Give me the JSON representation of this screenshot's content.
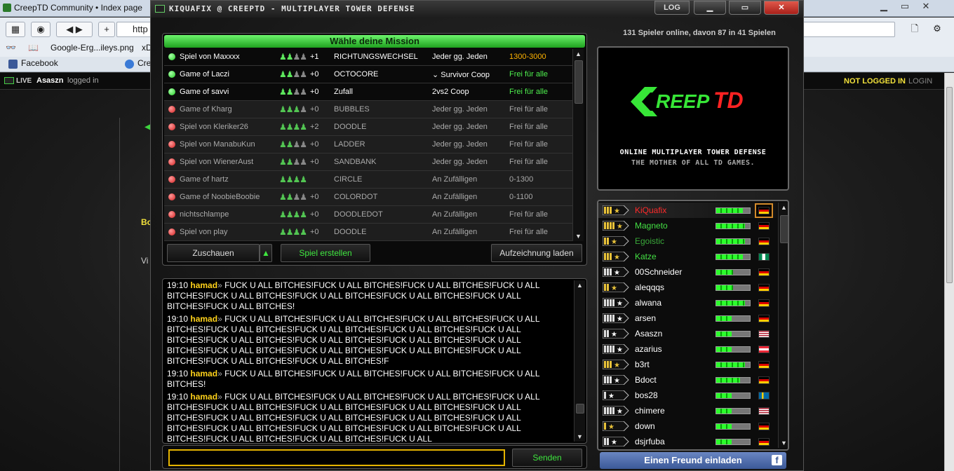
{
  "browser": {
    "tab_title": "CreepTD Community • Index page",
    "url_fragment": "http",
    "bookmarks": [
      "Google-Erg...ileys.png",
      "xD"
    ],
    "tabs": [
      "Facebook",
      "Cre"
    ],
    "site_bar": {
      "live_label": "LIVE",
      "username": "Asaszn",
      "logged_in": "logged in",
      "not_logged_in": "NOT LOGGED IN",
      "login": "LOGIN"
    },
    "page_bits": {
      "bo": "Bo",
      "vi": "Vi"
    }
  },
  "app": {
    "title": "KIQUAFIX @ CREEPTD - MULTIPLAYER TOWER DEFENSE",
    "log_button": "LOG",
    "minimize": "▁",
    "maximize": "▭",
    "close": "✕"
  },
  "missions": {
    "header": "Wähle deine Mission",
    "rows": [
      {
        "name": "Spiel von Maxxxx",
        "on": 2,
        "off": 2,
        "plus": "+1",
        "map": "RICHTUNGSWECHSEL",
        "mode": "Jeder gg. Jeden",
        "range": "1300-3000",
        "range_color": "orange",
        "state": "open"
      },
      {
        "name": "Game of Laczi",
        "on": 2,
        "off": 2,
        "plus": "+0",
        "map": "OCTOCORE",
        "mode": "⌄ Survivor Coop",
        "range": "Frei für alle",
        "range_color": "green",
        "state": "open"
      },
      {
        "name": "Game of savvi",
        "on": 2,
        "off": 2,
        "plus": "+0",
        "map": "Zufall",
        "mode": "2vs2 Coop",
        "range": "Frei für alle",
        "range_color": "green",
        "state": "open"
      },
      {
        "name": "Game of Kharg",
        "on": 3,
        "off": 1,
        "plus": "+0",
        "map": "BUBBLES",
        "mode": "Jeder gg. Jeden",
        "range": "Frei für alle",
        "range_color": "green",
        "state": "closed"
      },
      {
        "name": "Spiel von Kleriker26",
        "on": 4,
        "off": 0,
        "plus": "+2",
        "map": "DOODLE",
        "mode": "Jeder gg. Jeden",
        "range": "Frei für alle",
        "range_color": "green",
        "state": "closed"
      },
      {
        "name": "Spiel von ManabuKun",
        "on": 2,
        "off": 2,
        "plus": "+0",
        "map": "LADDER",
        "mode": "Jeder gg. Jeden",
        "range": "Frei für alle",
        "range_color": "green",
        "state": "closed"
      },
      {
        "name": "Spiel von WienerAust",
        "on": 2,
        "off": 2,
        "plus": "+0",
        "map": "SANDBANK",
        "mode": "Jeder gg. Jeden",
        "range": "Frei für alle",
        "range_color": "green",
        "state": "closed"
      },
      {
        "name": "Game of hartz",
        "on": 4,
        "off": 0,
        "plus": "",
        "map": "CIRCLE",
        "mode": "An Zufälligen",
        "range": "0-1300",
        "range_color": "green",
        "state": "closed"
      },
      {
        "name": "Game of NoobieBoobie",
        "on": 2,
        "off": 2,
        "plus": "+0",
        "map": "COLORDOT",
        "mode": "An Zufälligen",
        "range": "0-1100",
        "range_color": "green",
        "state": "closed"
      },
      {
        "name": "nichtschlampe",
        "on": 4,
        "off": 0,
        "plus": "+0",
        "map": "DOODLEDOT",
        "mode": "An Zufälligen",
        "range": "Frei für alle",
        "range_color": "green",
        "state": "closed"
      },
      {
        "name": "Spiel von play",
        "on": 4,
        "off": 0,
        "plus": "+0",
        "map": "DOODLE",
        "mode": "An Zufälligen",
        "range": "Frei für alle",
        "range_color": "green",
        "state": "closed"
      }
    ],
    "buttons": {
      "watch": "Zuschauen",
      "up": "▲",
      "create": "Spiel erstellen",
      "load": "Aufzeichnung laden"
    }
  },
  "chat": {
    "messages": [
      {
        "time": "19:10",
        "nick": "hamad",
        "sep": "» ",
        "text": "FUCK U ALL BITCHES!FUCK U ALL BITCHES!FUCK U ALL BITCHES!FUCK U ALL BITCHES!FUCK U ALL BITCHES!FUCK U ALL BITCHES!FUCK U ALL BITCHES!FUCK U ALL BITCHES!FUCK U ALL BITCHES!"
      },
      {
        "time": "19:10",
        "nick": "hamad",
        "sep": "» ",
        "text": "FUCK U ALL BITCHES!FUCK U ALL BITCHES!FUCK U ALL BITCHES!FUCK U ALL BITCHES!FUCK U ALL BITCHES!FUCK U ALL BITCHES!FUCK U ALL BITCHES!FUCK U ALL BITCHES!FUCK U ALL BITCHES!FUCK U ALL BITCHES!FUCK U ALL BITCHES!FUCK U ALL BITCHES!FUCK U ALL BITCHES!FUCK U ALL BITCHES!FUCK U ALL BITCHES!FUCK U ALL BITCHES!FUCK U ALL BITCHES!FUCK U ALL BITCHES!F"
      },
      {
        "time": "19:10",
        "nick": "hamad",
        "sep": "» ",
        "text": "FUCK U ALL BITCHES!FUCK U ALL BITCHES!FUCK U ALL BITCHES!FUCK U ALL BITCHES!"
      },
      {
        "time": "19:10",
        "nick": "hamad",
        "sep": "» ",
        "text": "FUCK U ALL BITCHES!FUCK U ALL BITCHES!FUCK U ALL BITCHES!FUCK U ALL BITCHES!FUCK U ALL BITCHES!FUCK U ALL BITCHES!FUCK U ALL BITCHES!FUCK U ALL BITCHES!FUCK U ALL BITCHES!FUCK U ALL BITCHES!FUCK U ALL BITCHES!FUCK U ALL BITCHES!FUCK U ALL BITCHES!FUCK U ALL BITCHES!FUCK U ALL BITCHES!FUCK U ALL BITCHES!FUCK U ALL BITCHES!FUCK U ALL BITCHES!FUCK U ALL"
      }
    ],
    "input_value": "",
    "send": "Senden"
  },
  "sidebar": {
    "online": "131 Spieler online, davon 87 in 41 Spielen",
    "logo_word_c": "C",
    "logo_word_reep": "REEP",
    "logo_word_td": "TD",
    "tagline1": "ONLINE MULTIPLAYER TOWER DEFENSE",
    "tagline2": "THE MOTHER OF ALL TD GAMES.",
    "invite": "Einen Freund einladen",
    "fb": "f"
  },
  "players": [
    {
      "name": "KiQuafix",
      "color": "#ff2a2a",
      "rank": "gold3",
      "hp": 0.8,
      "flag": "de"
    },
    {
      "name": "Magneto",
      "color": "#44e044",
      "rank": "gold4",
      "hp": 0.85,
      "flag": "de"
    },
    {
      "name": "Egoistic",
      "color": "#3aa83a",
      "rank": "gold2",
      "hp": 0.85,
      "flag": "de"
    },
    {
      "name": "Katze",
      "color": "#44e044",
      "rank": "gold3",
      "hp": 0.8,
      "flag": "ng"
    },
    {
      "name": "00Schneider",
      "color": "#ffffff",
      "rank": "grey3",
      "hp": 0.5,
      "flag": "de"
    },
    {
      "name": "aleqqqs",
      "color": "#ffffff",
      "rank": "gold2",
      "hp": 0.5,
      "flag": "de"
    },
    {
      "name": "alwana",
      "color": "#ffffff",
      "rank": "grey4",
      "hp": 0.85,
      "flag": "de"
    },
    {
      "name": "arsen",
      "color": "#ffffff",
      "rank": "grey4",
      "hp": 0.45,
      "flag": "de"
    },
    {
      "name": "Asaszn",
      "color": "#ffffff",
      "rank": "grey2",
      "hp": 0.45,
      "flag": "us"
    },
    {
      "name": "azarius",
      "color": "#ffffff",
      "rank": "grey4",
      "hp": 0.45,
      "flag": "at"
    },
    {
      "name": "b3rt",
      "color": "#ffffff",
      "rank": "gold3",
      "hp": 0.85,
      "flag": "de"
    },
    {
      "name": "Bdoct",
      "color": "#ffffff",
      "rank": "grey3",
      "hp": 0.7,
      "flag": "de"
    },
    {
      "name": "bos28",
      "color": "#ffffff",
      "rank": "grey1",
      "hp": 0.45,
      "flag": "se"
    },
    {
      "name": "chimere",
      "color": "#ffffff",
      "rank": "grey4",
      "hp": 0.45,
      "flag": "us"
    },
    {
      "name": "down",
      "color": "#ffffff",
      "rank": "gold1",
      "hp": 0.45,
      "flag": "de"
    },
    {
      "name": "dsjrfuba",
      "color": "#ffffff",
      "rank": "grey2",
      "hp": 0.45,
      "flag": "de"
    }
  ]
}
